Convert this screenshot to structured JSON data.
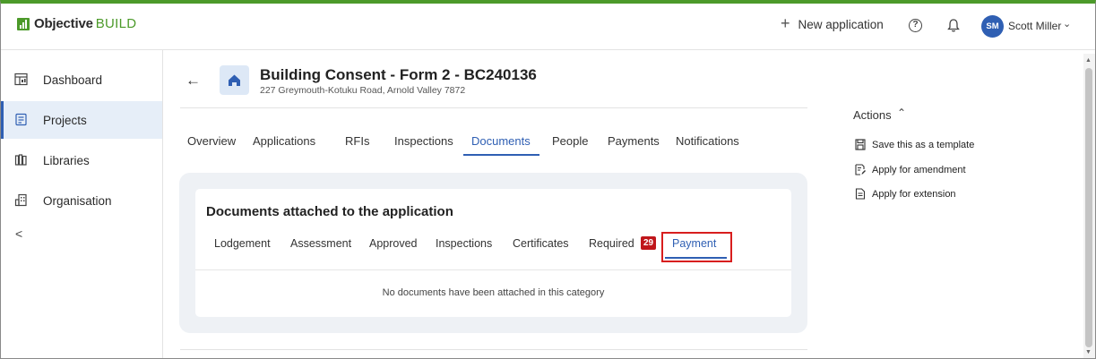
{
  "brand": {
    "name_bold": "Objective",
    "name_light": "BUILD",
    "accent_color": "#4c9a2a"
  },
  "header": {
    "new_application_label": "New application",
    "help_icon": "question-circle-icon",
    "notifications_icon": "bell-icon",
    "user": {
      "initials": "SM",
      "name": "Scott Miller"
    }
  },
  "sidebar": {
    "items": [
      {
        "label": "Dashboard",
        "icon": "dashboard-icon",
        "active": false
      },
      {
        "label": "Projects",
        "icon": "projects-icon",
        "active": true
      },
      {
        "label": "Libraries",
        "icon": "libraries-icon",
        "active": false
      },
      {
        "label": "Organisation",
        "icon": "organisation-icon",
        "active": false
      }
    ],
    "collapse_glyph": "<"
  },
  "application": {
    "title": "Building Consent - Form 2 - BC240136",
    "address": "227 Greymouth-Kotuku Road, Arnold Valley 7872"
  },
  "tabs": [
    {
      "label": "Overview",
      "active": false
    },
    {
      "label": "Applications",
      "active": false
    },
    {
      "label": "RFIs",
      "active": false
    },
    {
      "label": "Inspections",
      "active": false
    },
    {
      "label": "Documents",
      "active": true
    },
    {
      "label": "People",
      "active": false
    },
    {
      "label": "Payments",
      "active": false
    },
    {
      "label": "Notifications",
      "active": false
    }
  ],
  "documents": {
    "title": "Documents attached to the application",
    "subtabs": [
      {
        "label": "Lodgement"
      },
      {
        "label": "Assessment"
      },
      {
        "label": "Approved"
      },
      {
        "label": "Inspections"
      },
      {
        "label": "Certificates"
      },
      {
        "label": "Required",
        "badge": "29"
      },
      {
        "label": "Payment",
        "active": true
      }
    ],
    "empty_message": "No documents have been attached in this category"
  },
  "actions": {
    "heading": "Actions",
    "items": [
      {
        "label": "Save this as a template",
        "icon": "save-icon"
      },
      {
        "label": "Apply for amendment",
        "icon": "edit-document-icon"
      },
      {
        "label": "Apply for extension",
        "icon": "document-icon"
      }
    ]
  },
  "colors": {
    "primary": "#2f5fb3",
    "highlight_box": "#d81e1e",
    "badge": "#c0161b"
  }
}
